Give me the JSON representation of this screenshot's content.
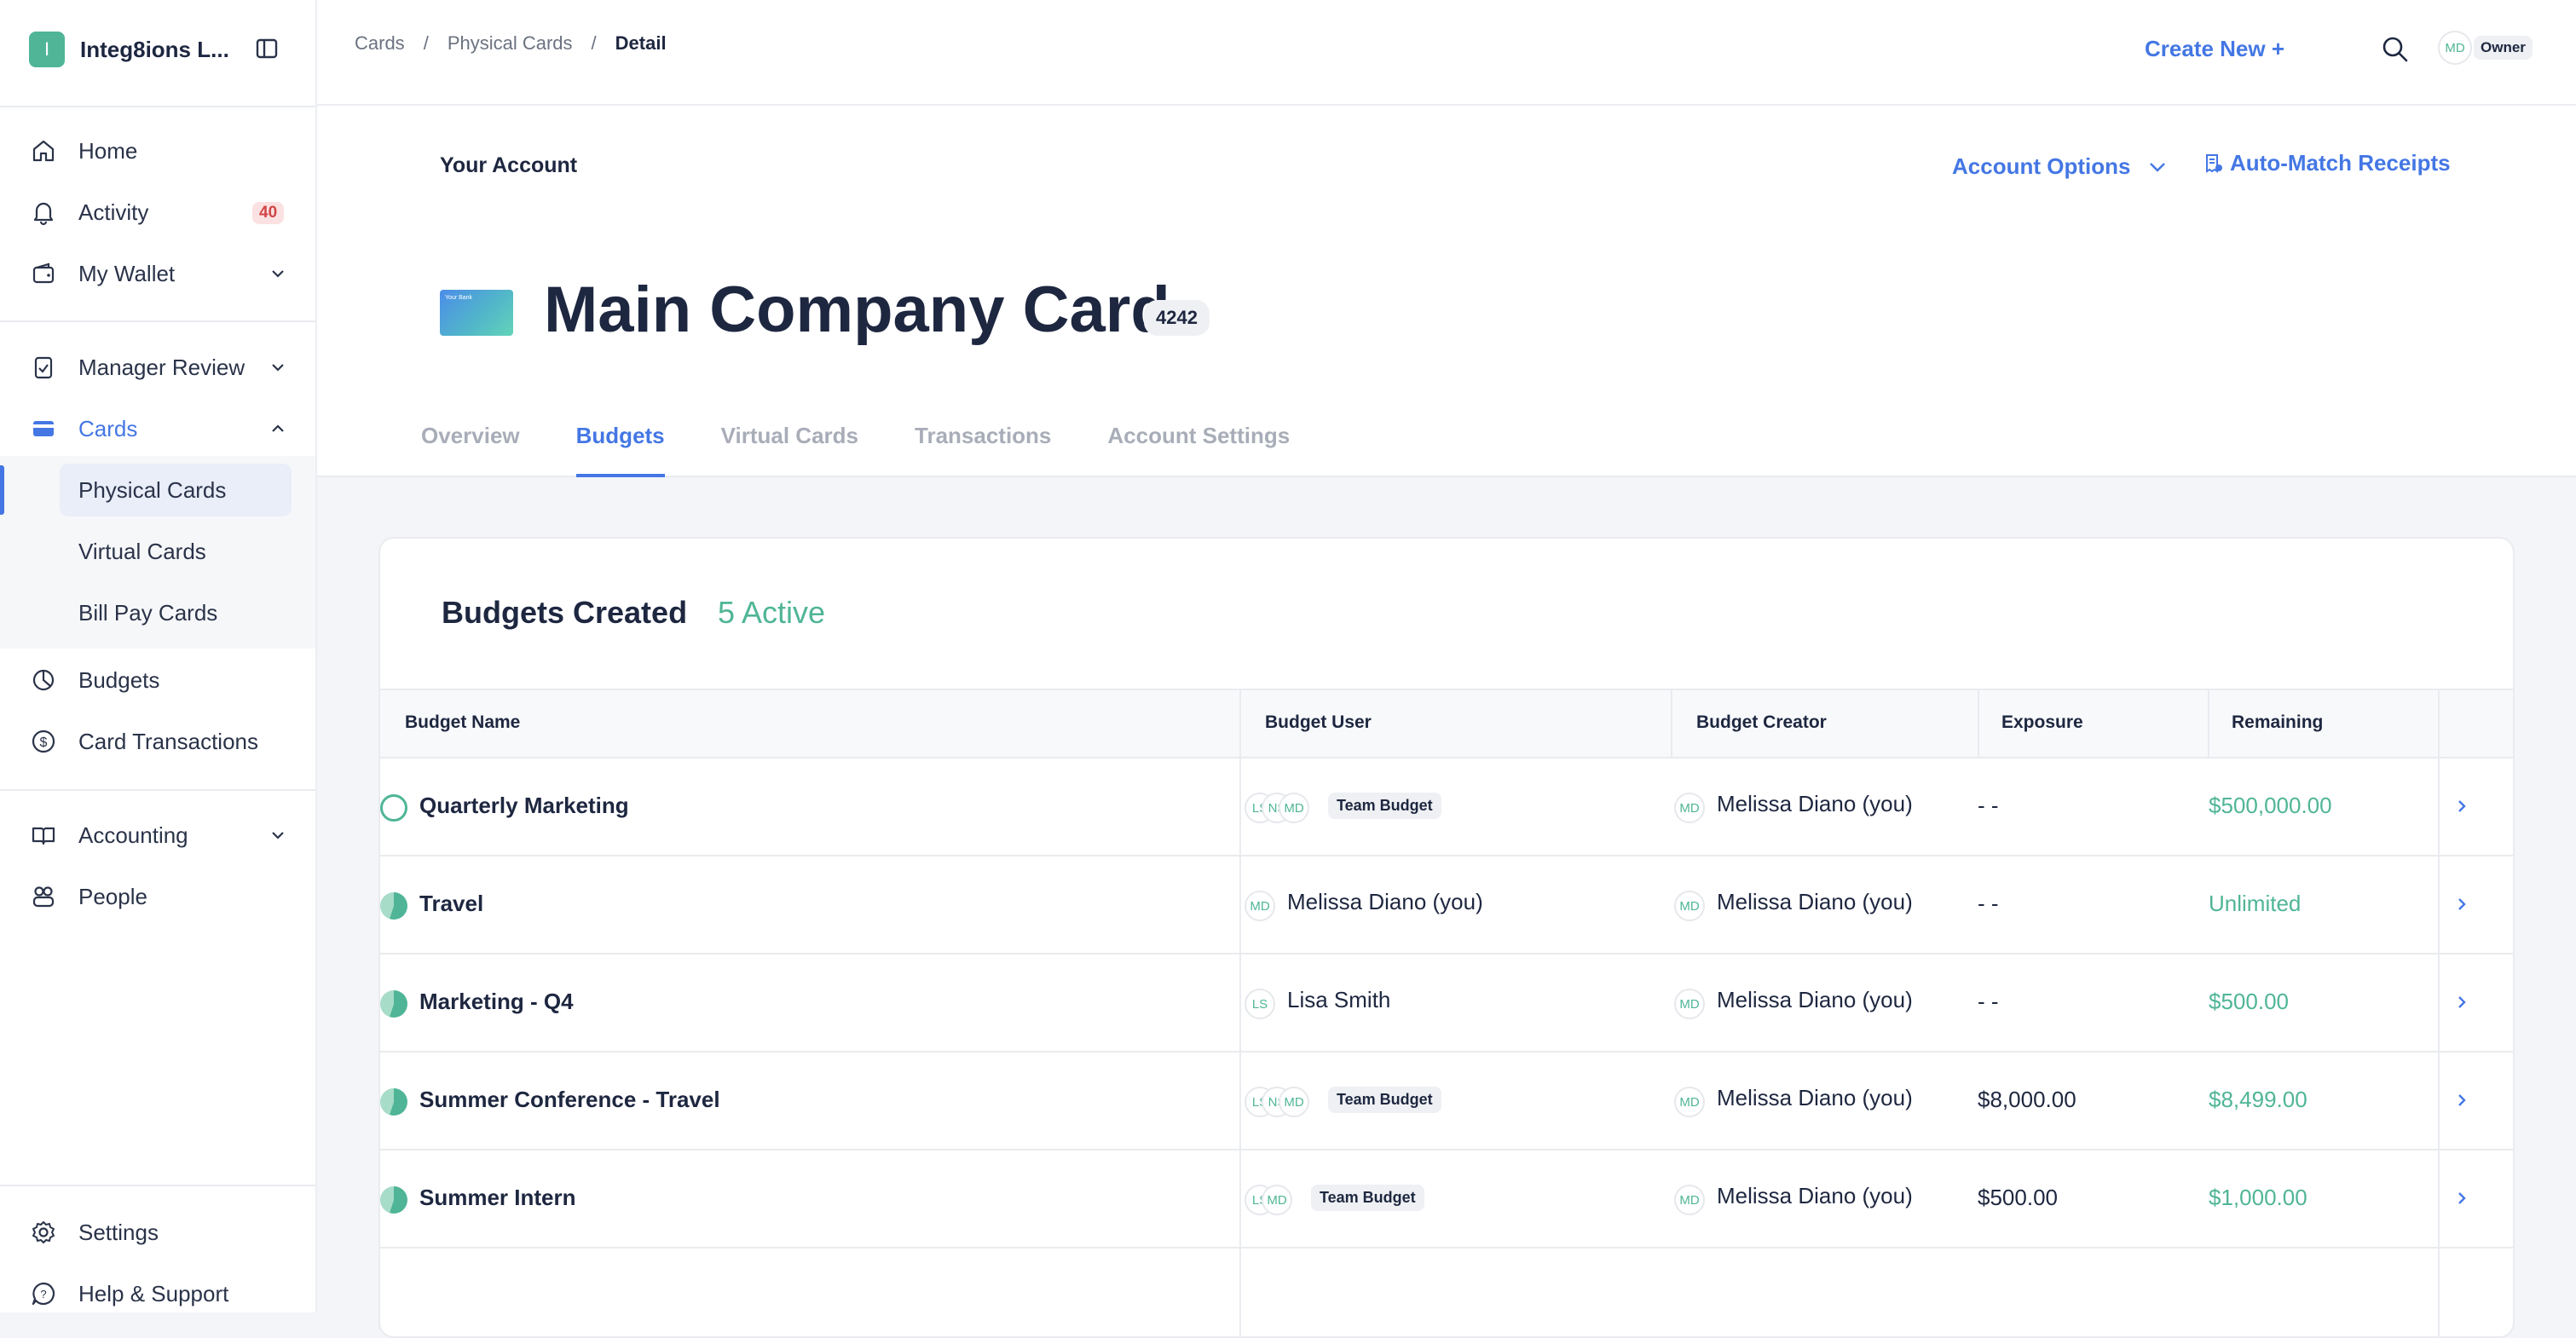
{
  "brand": {
    "initial": "I",
    "name": "Integ8ions L..."
  },
  "sidebar": {
    "items": [
      {
        "label": "Home"
      },
      {
        "label": "Activity",
        "badge": "40"
      },
      {
        "label": "My Wallet"
      },
      {
        "label": "Manager Review"
      },
      {
        "label": "Cards"
      },
      {
        "label": "Budgets"
      },
      {
        "label": "Card Transactions"
      },
      {
        "label": "Accounting"
      },
      {
        "label": "People"
      },
      {
        "label": "Settings"
      },
      {
        "label": "Help & Support"
      }
    ],
    "cards_sub": [
      {
        "label": "Physical Cards"
      },
      {
        "label": "Virtual Cards"
      },
      {
        "label": "Bill Pay Cards"
      }
    ]
  },
  "topbar": {
    "breadcrumb": [
      "Cards",
      "Physical Cards",
      "Detail"
    ],
    "create_new": "Create New +",
    "avatar": "MD",
    "role": "Owner"
  },
  "header": {
    "your_account": "Your Account",
    "account_options": "Account Options",
    "auto_match": "Auto-Match Receipts",
    "card_thumb_text": "Your Bank",
    "card_title": "Main Company Card",
    "last4": "4242",
    "tabs": [
      "Overview",
      "Budgets",
      "Virtual Cards",
      "Transactions",
      "Account Settings"
    ],
    "active_tab": "Budgets"
  },
  "budgets": {
    "title": "Budgets Created",
    "active_count": "5 Active",
    "columns": [
      "Budget Name",
      "Budget User",
      "Budget Creator",
      "Exposure",
      "Remaining"
    ],
    "rows": [
      {
        "name": "Quarterly Marketing",
        "users": [
          "LS",
          "NS",
          "MD"
        ],
        "user_label": "Team Budget",
        "creator_initials": "MD",
        "creator": "Melissa Diano (you)",
        "exposure": "- -",
        "remaining": "$500,000.00"
      },
      {
        "name": "Travel",
        "users": [
          "MD"
        ],
        "user_label": "Melissa Diano (you)",
        "creator_initials": "MD",
        "creator": "Melissa Diano (you)",
        "exposure": "- -",
        "remaining": "Unlimited"
      },
      {
        "name": "Marketing - Q4",
        "users": [
          "LS"
        ],
        "user_label": "Lisa Smith",
        "creator_initials": "MD",
        "creator": "Melissa Diano (you)",
        "exposure": "- -",
        "remaining": "$500.00"
      },
      {
        "name": "Summer Conference - Travel",
        "users": [
          "LS",
          "NS",
          "MD"
        ],
        "user_label": "Team Budget",
        "creator_initials": "MD",
        "creator": "Melissa Diano (you)",
        "exposure": "$8,000.00",
        "remaining": "$8,499.00"
      },
      {
        "name": "Summer Intern",
        "users": [
          "LS",
          "MD"
        ],
        "user_label": "Team Budget",
        "creator_initials": "MD",
        "creator": "Melissa Diano (you)",
        "exposure": "$500.00",
        "remaining": "$1,000.00"
      }
    ]
  },
  "colors": {
    "accent": "#4477e4",
    "success": "#4fb596",
    "badge_red": "#d14545"
  }
}
